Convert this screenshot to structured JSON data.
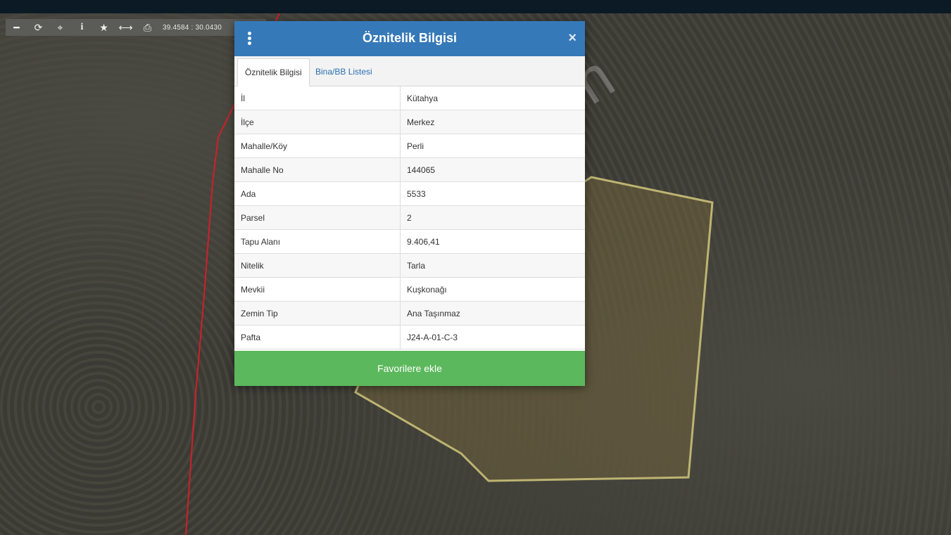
{
  "toolbar": {
    "coords": "39.4584 : 30.0430",
    "icons": [
      "zoom-out-icon",
      "refresh-icon",
      "crosshair-icon",
      "info-icon",
      "star-icon",
      "measure-icon",
      "print-icon"
    ]
  },
  "modal": {
    "title": "Öznitelik Bilgisi",
    "close": "×",
    "tabs": [
      {
        "label": "Öznitelik Bilgisi"
      },
      {
        "label": "Bina/BB Listesi"
      }
    ],
    "rows": [
      {
        "key": "İl",
        "value": "Kütahya"
      },
      {
        "key": "İlçe",
        "value": "Merkez"
      },
      {
        "key": "Mahalle/Köy",
        "value": "Perli"
      },
      {
        "key": "Mahalle No",
        "value": "144065"
      },
      {
        "key": "Ada",
        "value": "5533"
      },
      {
        "key": "Parsel",
        "value": "2"
      },
      {
        "key": "Tapu Alanı",
        "value": "9.406,41"
      },
      {
        "key": "Nitelik",
        "value": "Tarla"
      },
      {
        "key": "Mevkii",
        "value": "Kuşkonağı"
      },
      {
        "key": "Zemin Tip",
        "value": "Ana Taşınmaz"
      },
      {
        "key": "Pafta",
        "value": "J24-A-01-C-3"
      }
    ],
    "favorite_label": "Favorilere ekle"
  },
  "watermark": "emlakjet.com",
  "colors": {
    "header": "#3579b8",
    "button": "#5cb85c",
    "parcel_outline": "#bdb472",
    "boundary_line": "#d0202a"
  }
}
